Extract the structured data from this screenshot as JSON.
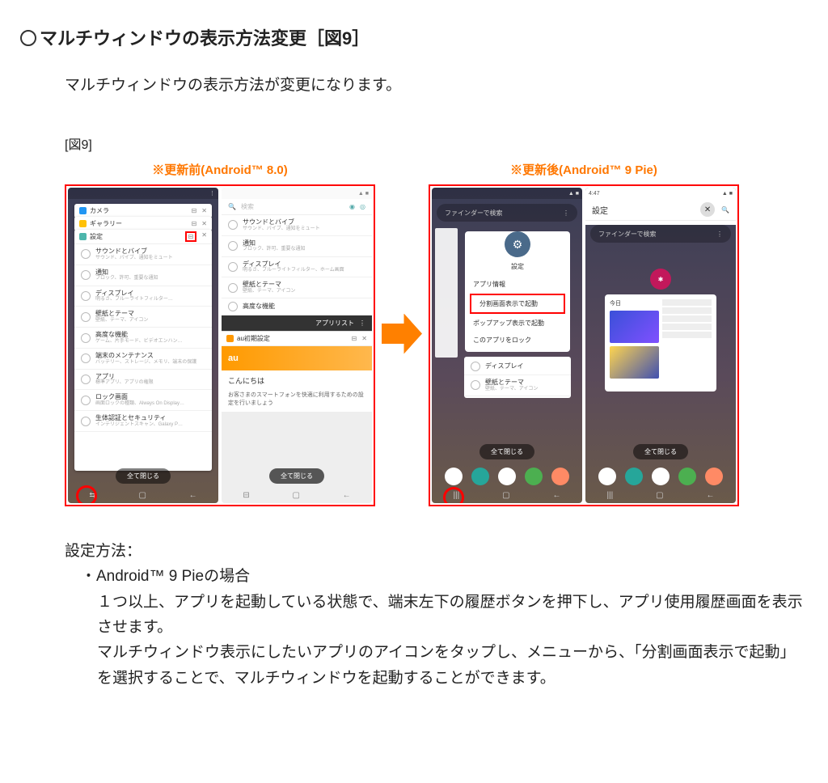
{
  "title_prefix_symbol": "○",
  "title": "マルチウィンドウの表示方法変更［図9］",
  "description": "マルチウィンドウの表示方法が変更になります。",
  "figure_label": "[図9]",
  "before": {
    "heading": "※更新前(Android™ 8.0)",
    "left": {
      "cards": [
        {
          "icon": "camera",
          "label": "カメラ"
        },
        {
          "icon": "gallery",
          "label": "ギャラリー"
        },
        {
          "icon": "settings",
          "label": "設定"
        }
      ],
      "settings": [
        {
          "title": "サウンドとバイブ",
          "sub": "サウンド、バイブ、通知をミュート"
        },
        {
          "title": "通知",
          "sub": "ブロック、許可、重要な通知"
        },
        {
          "title": "ディスプレイ",
          "sub": "明るさ、ブルーライトフィルター…"
        },
        {
          "title": "壁紙とテーマ",
          "sub": "壁紙、テーマ、アイコン"
        },
        {
          "title": "高度な機能",
          "sub": "ゲーム、片手モード、ビデオエンハン…"
        },
        {
          "title": "端末のメンテナンス",
          "sub": "バッテリー、ストレージ、メモリ、端末の保護"
        },
        {
          "title": "アプリ",
          "sub": "標準アプリ、アプリの権限"
        },
        {
          "title": "ロック画面",
          "sub": "画面ロックの種類、Always On Display…"
        },
        {
          "title": "生体認証とセキュリティ",
          "sub": "インテリジェントスキャン、Galaxy P…"
        }
      ],
      "close_all": "全て閉じる"
    },
    "right": {
      "search_placeholder": "検索",
      "settings": [
        {
          "title": "サウンドとバイブ",
          "sub": "サウンド、バイブ、通知をミュート"
        },
        {
          "title": "通知",
          "sub": "ブロック、許可、重要な通知"
        },
        {
          "title": "ディスプレイ",
          "sub": "明るさ、ブルーライトフィルター、ホーム画面"
        },
        {
          "title": "壁紙とテーマ",
          "sub": "壁紙、テーマ、アイコン"
        },
        {
          "title": "高度な機能",
          "sub": ""
        }
      ],
      "applist_header": "アプリリスト",
      "au_card": {
        "title": "au初期設定",
        "brand": "au",
        "greeting": "こんにちは",
        "body": "お客さまのスマートフォンを快適に利用するための設定を行いましょう"
      },
      "close_all": "全て閉じる"
    }
  },
  "after": {
    "heading": "※更新後(Android™ 9 Pie)",
    "left": {
      "finder_placeholder": "ファインダーで検索",
      "popup_title": "設定",
      "popup_items": [
        "アプリ情報",
        "分割画面表示で起動",
        "ポップアップ表示で起動",
        "このアプリをロック"
      ],
      "mini_settings": [
        {
          "title": "ディスプレイ"
        },
        {
          "title": "壁紙とテーマ",
          "sub": "壁紙、テーマ、アイコン"
        }
      ],
      "close_all": "全て閉じる"
    },
    "right": {
      "time": "4:47",
      "settings_label": "設定",
      "finder_placeholder": "ファインダーで検索",
      "card_today": "今日",
      "close_all": "全て閉じる"
    }
  },
  "instructions": {
    "heading": "設定方法：",
    "bullet": "・Android™ 9 Pieの場合",
    "lines": [
      "１つ以上、アプリを起動している状態で、端末左下の履歴ボタンを押下し、アプリ使用履歴画面を表示させます。",
      "マルチウィンドウ表示にしたいアプリのアイコンをタップし、メニューから、「分割画面表示で起動」を選択することで、マルチウィンドウを起動することができます。"
    ]
  }
}
